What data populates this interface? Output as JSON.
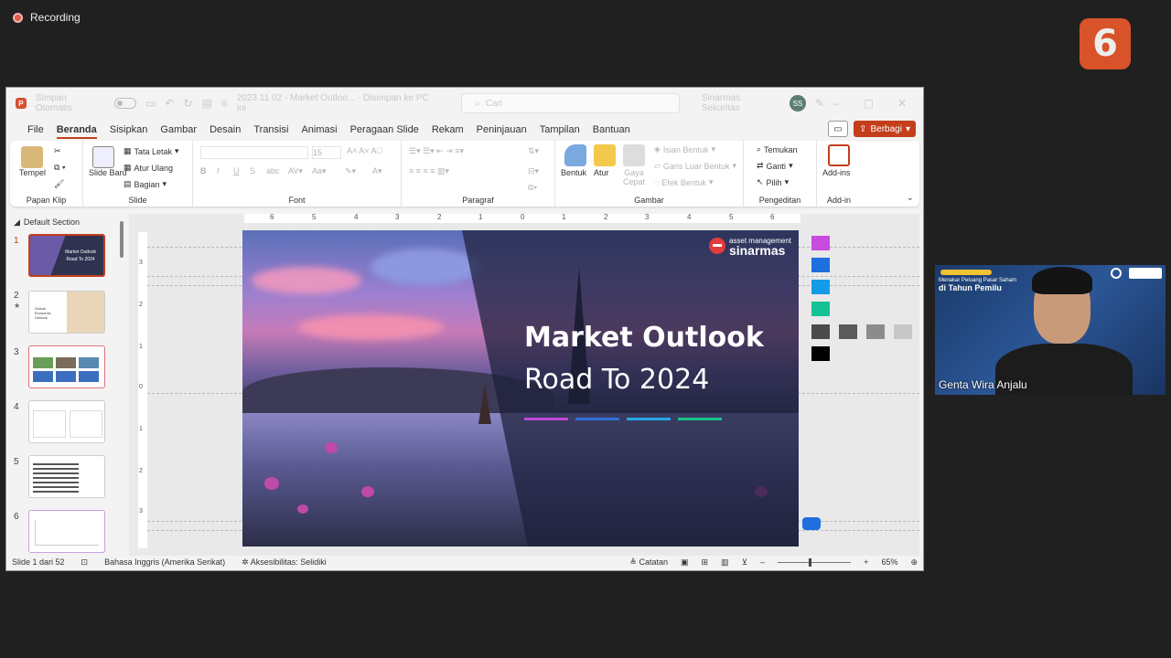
{
  "recording": {
    "label": "Recording"
  },
  "overlay_logo": {
    "text": "6",
    "color": "#e8582a"
  },
  "titlebar": {
    "autosave_label": "Simpan Otomatis",
    "document": "2023 11 02 - Market Outloo... · Disimpan ke PC ini",
    "search_placeholder": "Cari",
    "account": "Sinarmas Sekuritas",
    "avatar": "SS"
  },
  "menu": {
    "items": [
      "File",
      "Beranda",
      "Sisipkan",
      "Gambar",
      "Desain",
      "Transisi",
      "Animasi",
      "Peragaan Slide",
      "Rekam",
      "Peninjauan",
      "Tampilan",
      "Bantuan"
    ],
    "active": "Beranda",
    "share_label": "Berbagi"
  },
  "ribbon": {
    "clipboard": {
      "paste": "Tempel",
      "group": "Papan Klip"
    },
    "slides": {
      "new_slide": "Slide Baru",
      "layout": "Tata Letak",
      "reset": "Atur Ulang",
      "section": "Bagian",
      "group": "Slide"
    },
    "font": {
      "size": "15",
      "group": "Font"
    },
    "paragraph": {
      "group": "Paragraf"
    },
    "drawing": {
      "shape": "Bentuk",
      "arrange": "Atur",
      "quick_styles": "Gaya Cepat",
      "fill": "Isian Bentuk",
      "outline": "Garis Luar Bentuk",
      "effects": "Efek Bentuk",
      "group": "Gambar"
    },
    "editing": {
      "find": "Temukan",
      "replace": "Ganti",
      "select": "Pilih",
      "group": "Pengeditan"
    },
    "addins": {
      "label": "Add-ins",
      "group": "Add-in"
    }
  },
  "thumbnails": {
    "section": "Default Section",
    "slides": [
      {
        "num": "1",
        "lines": [
          "Market Outlook",
          "Road To 2024"
        ]
      },
      {
        "num": "2",
        "lines": [
          "Global",
          "Economic",
          "Outlook"
        ]
      },
      {
        "num": "3",
        "lines": []
      },
      {
        "num": "4",
        "lines": []
      },
      {
        "num": "5",
        "lines": []
      },
      {
        "num": "6",
        "lines": []
      }
    ]
  },
  "slide": {
    "brand_small": "asset management",
    "brand_big": "sinarmas",
    "title": "Market Outlook",
    "subtitle": "Road To 2024",
    "accent_colors": [
      "#c14bd6",
      "#2f6fd8",
      "#23a7e8",
      "#16c28a"
    ],
    "swatches": [
      "#c94be0",
      "#1f6fde",
      "#139be8",
      "#14c296",
      "#4a4a4a",
      "#5a5a5a",
      "#8c8c8c",
      "#c7c7c7",
      "#000000"
    ]
  },
  "rulers": {
    "h": [
      "6",
      "5",
      "4",
      "3",
      "2",
      "1",
      "0",
      "1",
      "2",
      "3",
      "4",
      "5",
      "6"
    ],
    "v": [
      "3",
      "2",
      "1",
      "0",
      "1",
      "2",
      "3"
    ]
  },
  "status": {
    "slide_count": "Slide 1 dari 52",
    "language": "Bahasa Inggris (Amerika Serikat)",
    "accessibility": "Aksesibilitas: Selidiki",
    "notes": "Catatan",
    "zoom": "65%"
  },
  "webcam": {
    "banner_sub": "Menakar Peluang Pasar Saham",
    "banner_title": "di Tahun Pemilu",
    "name": "Genta Wira Anjalu"
  }
}
